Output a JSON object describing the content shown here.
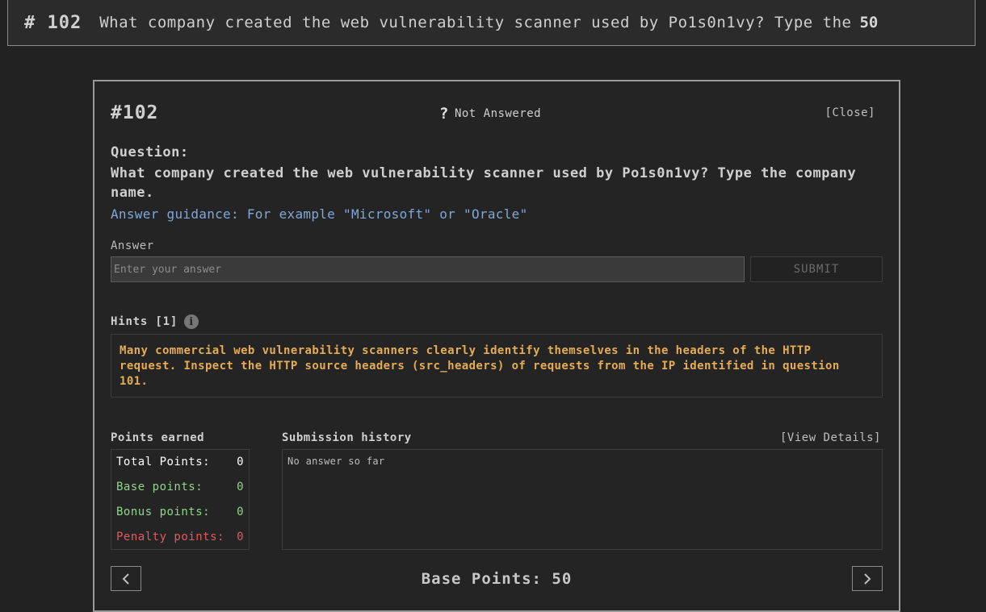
{
  "top_bar": {
    "number": "# 102",
    "question": "What company created the web vulnerability scanner used by Po1s0n1vy? Type the",
    "points": "50"
  },
  "modal": {
    "id": "#102",
    "status_icon": "?",
    "status": "Not Answered",
    "close": "[Close]",
    "question_label": "Question:",
    "question_text": "What company created the web vulnerability scanner used by Po1s0n1vy? Type the company name.",
    "guidance": "Answer guidance: For example \"Microsoft\" or \"Oracle\"",
    "answer_label": "Answer",
    "answer_placeholder": "Enter your answer",
    "answer_value": "",
    "submit_label": "SUBMIT",
    "hints_label": "Hints [1]",
    "hint_text": "Many commercial web vulnerability scanners clearly identify themselves in the headers of the HTTP request. Inspect the HTTP source headers (src_headers) of requests from the IP identified in question 101.",
    "points_earned_label": "Points earned",
    "points": {
      "total_label": "Total Points:",
      "total": "0",
      "base_label": "Base points:",
      "base": "0",
      "bonus_label": "Bonus points:",
      "bonus": "0",
      "penalty_label": "Penalty points:",
      "penalty": "0"
    },
    "history_label": "Submission history",
    "view_details": "[View Details]",
    "history_text": "No answer so far",
    "base_points": "Base Points: 50",
    "prev_icon": "chevron-left-icon",
    "next_icon": "chevron-right-icon"
  },
  "colors": {
    "background": "#222222",
    "guidance": "#7fa8d8",
    "hint": "#e5ac53",
    "positive": "#8fd68a",
    "penalty": "#e05b61"
  }
}
